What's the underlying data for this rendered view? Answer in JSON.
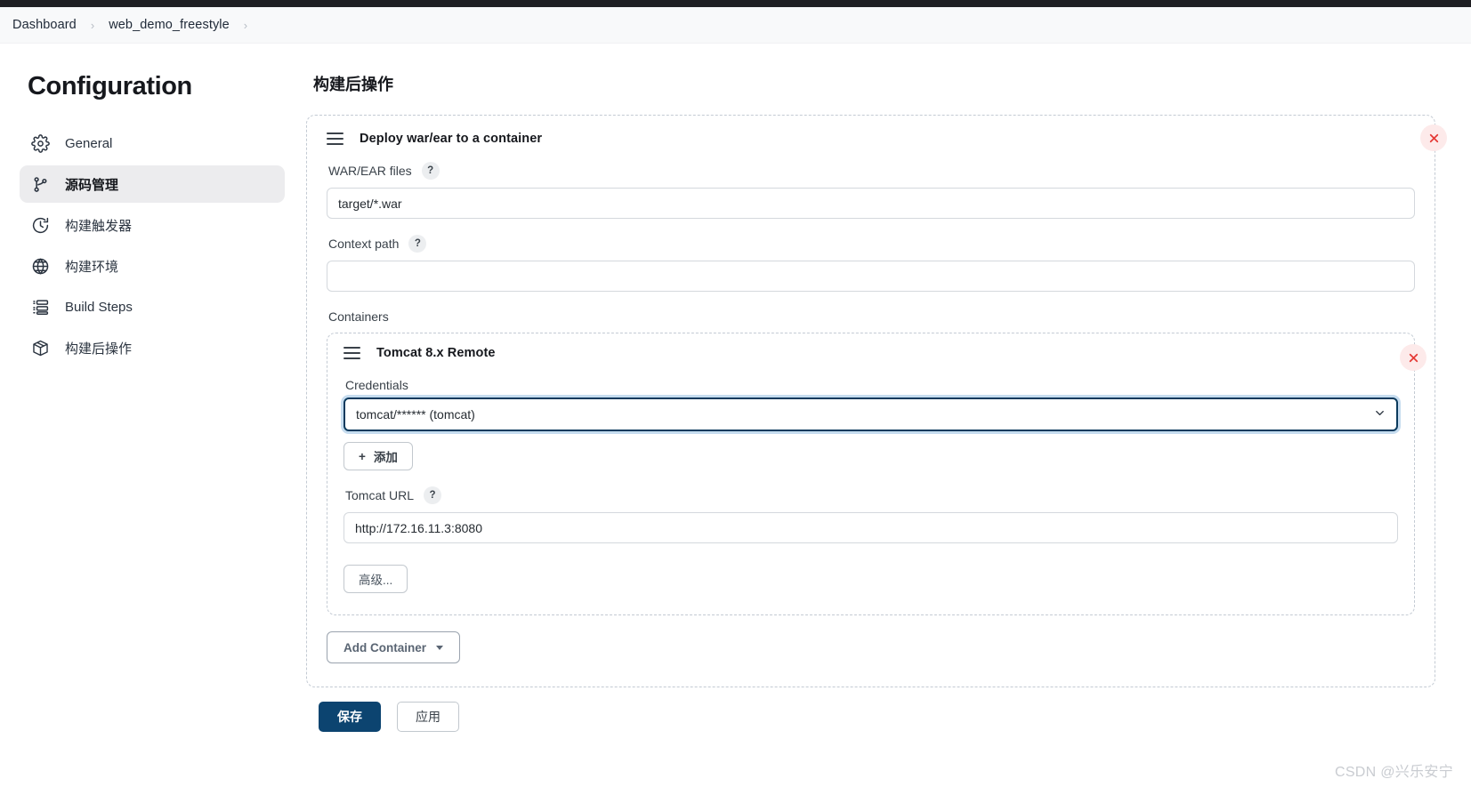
{
  "breadcrumb": {
    "items": [
      "Dashboard",
      "web_demo_freestyle"
    ],
    "separator": "›"
  },
  "sidebar": {
    "title": "Configuration",
    "items": [
      {
        "label": "General",
        "icon": "gear-icon",
        "active": false
      },
      {
        "label": "源码管理",
        "icon": "branch-icon",
        "active": true
      },
      {
        "label": "构建触发器",
        "icon": "clock-icon",
        "active": false
      },
      {
        "label": "构建环境",
        "icon": "globe-icon",
        "active": false
      },
      {
        "label": "Build Steps",
        "icon": "list-icon",
        "active": false
      },
      {
        "label": "构建后操作",
        "icon": "package-icon",
        "active": false
      }
    ]
  },
  "main": {
    "title": "构建后操作",
    "publisher": {
      "title": "Deploy war/ear to a container",
      "grip_icon": "drag-handle-icon",
      "close_icon": "close-icon",
      "war_label": "WAR/EAR files",
      "war_help": "?",
      "war_value": "target/*.war",
      "war_placeholder": "",
      "context_label": "Context path",
      "context_help": "?",
      "context_value": "",
      "context_placeholder": "",
      "containers_label": "Containers",
      "add_container_label": "Add Container",
      "add_container_caret": "chevron-down-icon"
    },
    "container": {
      "title": "Tomcat 8.x Remote",
      "grip_icon": "drag-handle-icon",
      "close_icon": "close-icon",
      "credentials_label": "Credentials",
      "credentials_value": "tomcat/****** (tomcat)",
      "credentials_caret": "chevron-down-icon",
      "add_label": "添加",
      "add_plus": "+",
      "url_label": "Tomcat URL",
      "url_help": "?",
      "url_value": "http://172.16.11.3:8080",
      "url_placeholder": "",
      "advanced_label": "高级..."
    }
  },
  "footer": {
    "save_label": "保存",
    "apply_label": "应用"
  },
  "watermark": "CSDN @兴乐安宁",
  "colors": {
    "accent": "#0c4470",
    "danger": "#e53935",
    "dashed_border": "#c3cad3",
    "sidebar_active_bg": "#ececee"
  }
}
